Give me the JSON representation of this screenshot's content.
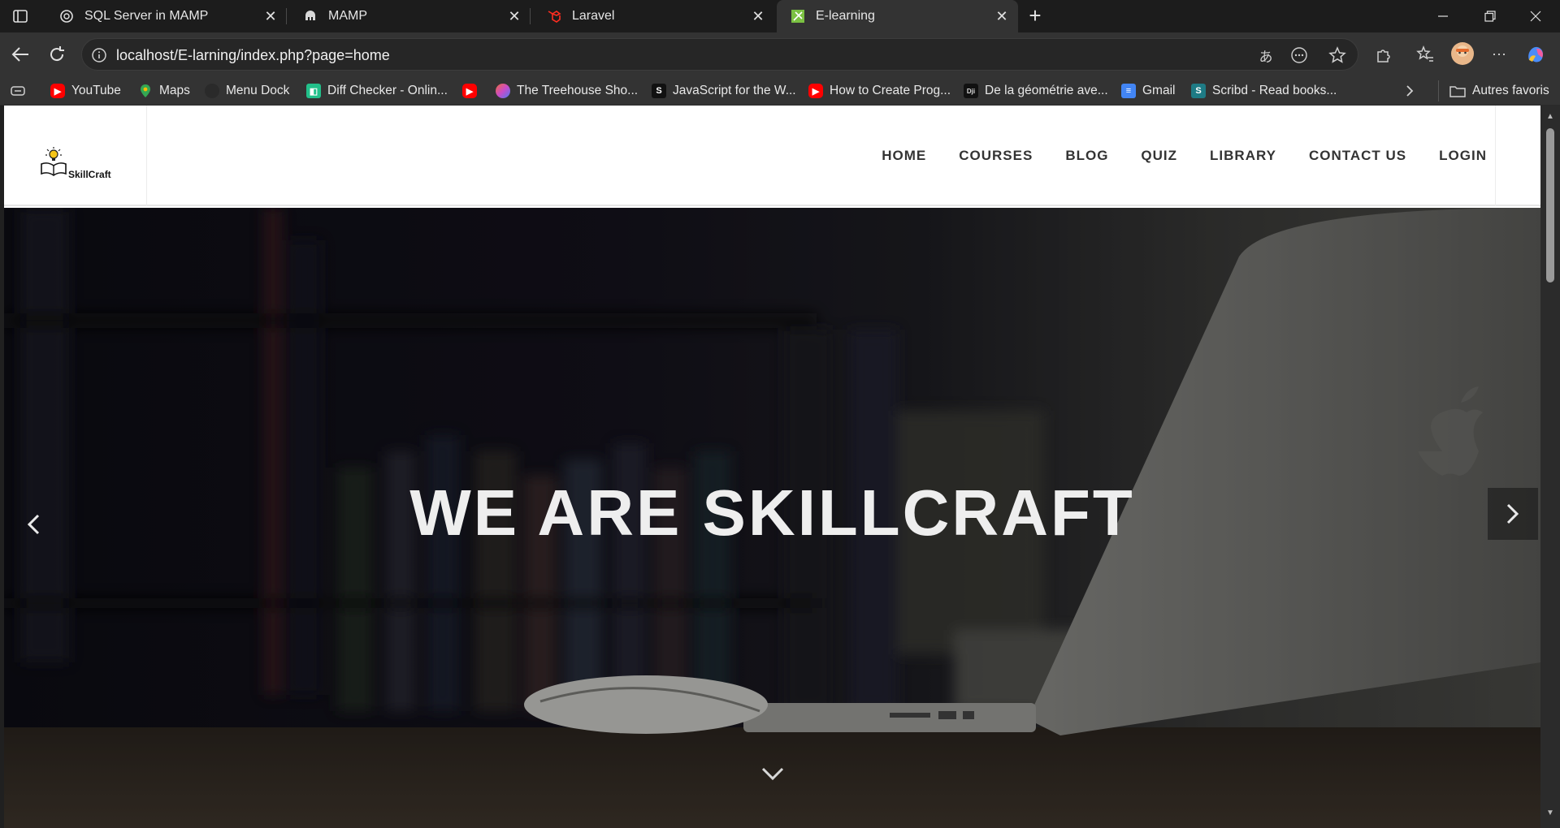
{
  "browser": {
    "tabs": [
      {
        "title": "SQL Server in MAMP",
        "icon": "openai-icon"
      },
      {
        "title": "MAMP",
        "icon": "elephant-icon"
      },
      {
        "title": "Laravel",
        "icon": "laravel-icon"
      },
      {
        "title": "E-learning",
        "icon": "page-icon",
        "active": true
      }
    ],
    "url": "localhost/E-larning/index.php?page=home",
    "bookmarks": [
      {
        "label": "YouTube",
        "icon": "youtube-icon",
        "color": "#ff0000"
      },
      {
        "label": "Maps",
        "icon": "maps-icon",
        "color": "#34a853"
      },
      {
        "label": "Menu Dock",
        "icon": "menu-dock-icon",
        "color": "#2a2a2a"
      },
      {
        "label": "Diff Checker - Onlin...",
        "icon": "diff-checker-icon",
        "color": "#22c08a"
      },
      {
        "label": "",
        "icon": "youtube-icon",
        "color": "#ff0000"
      },
      {
        "label": "The Treehouse Sho...",
        "icon": "treehouse-icon",
        "color": "#d94fa3"
      },
      {
        "label": "JavaScript for the W...",
        "icon": "s-icon",
        "color": "#111111"
      },
      {
        "label": "How to Create Prog...",
        "icon": "youtube-icon",
        "color": "#ff0000"
      },
      {
        "label": "De la géométrie ave...",
        "icon": "dji-icon",
        "color": "#111111"
      },
      {
        "label": "Gmail",
        "icon": "gdocs-icon",
        "color": "#4285f4"
      },
      {
        "label": "Scribd - Read books...",
        "icon": "scribd-icon",
        "color": "#1e7b85"
      }
    ],
    "other_favorites": "Autres favoris"
  },
  "site": {
    "logo_text": "SkillCraft",
    "menu": [
      "HOME",
      "COURSES",
      "BLOG",
      "QUIZ",
      "LIBRARY",
      "CONTACT US",
      "LOGIN"
    ],
    "hero_title": "WE ARE SKILLCRAFT"
  },
  "colors": {
    "chrome_dark": "#1c1c1c",
    "toolbar": "#333333",
    "nav_text": "#333333",
    "hero_text": "#eeeeee"
  }
}
